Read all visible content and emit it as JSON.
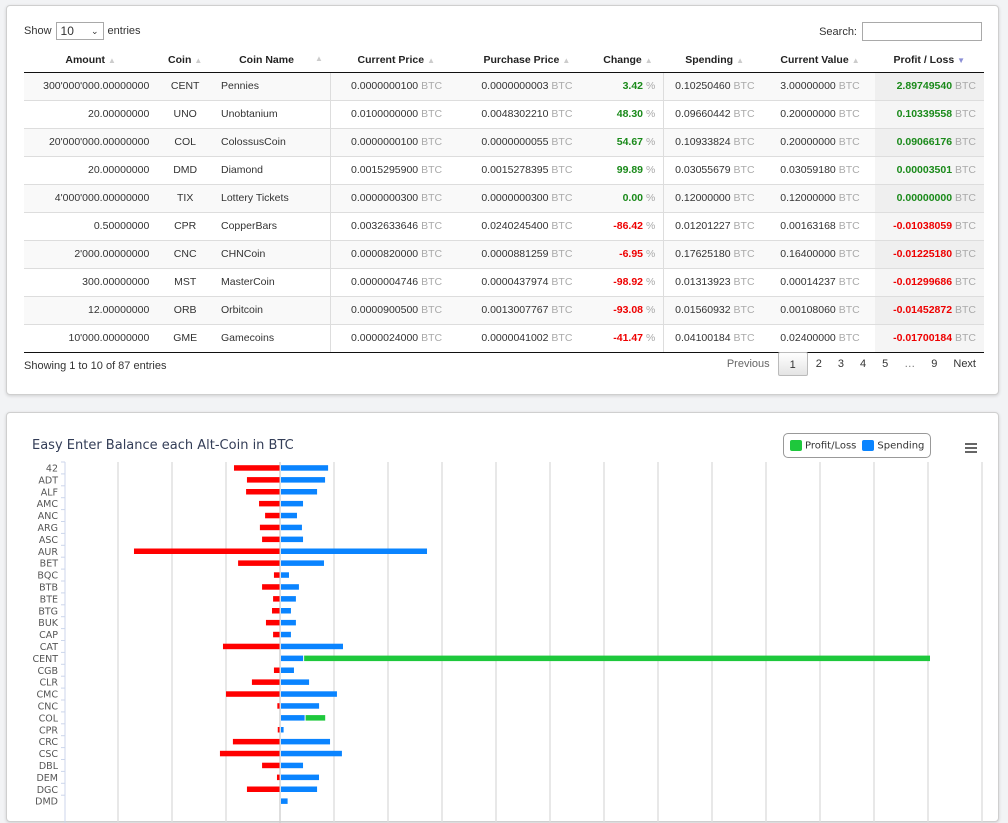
{
  "table": {
    "length_label_pre": "Show",
    "length_value": "10",
    "length_label_post": "entries",
    "search_label": "Search:",
    "search_value": "",
    "columns": [
      {
        "label": "Amount",
        "sort": "both"
      },
      {
        "label": "Coin",
        "sort": "both"
      },
      {
        "label": "Coin Name",
        "sort": "both"
      },
      {
        "label": "Current Price",
        "sort": "both"
      },
      {
        "label": "Purchase Price",
        "sort": "both"
      },
      {
        "label": "Change",
        "sort": "both"
      },
      {
        "label": "Spending",
        "sort": "both"
      },
      {
        "label": "Current Value",
        "sort": "both"
      },
      {
        "label": "Profit / Loss",
        "sort": "desc"
      }
    ],
    "unit_btc": "BTC",
    "unit_pct": "%",
    "rows": [
      {
        "amount": "300'000'000.00000000",
        "coin": "CENT",
        "name": "Pennies",
        "current_price": "0.0000000100",
        "purchase_price": "0.0000000003",
        "change": "3.42",
        "change_sign": "pos",
        "spending": "0.10250460",
        "current_value": "3.00000000",
        "profit": "2.89749540",
        "profit_sign": "pos"
      },
      {
        "amount": "20.00000000",
        "coin": "UNO",
        "name": "Unobtanium",
        "current_price": "0.0100000000",
        "purchase_price": "0.0048302210",
        "change": "48.30",
        "change_sign": "pos",
        "spending": "0.09660442",
        "current_value": "0.20000000",
        "profit": "0.10339558",
        "profit_sign": "pos"
      },
      {
        "amount": "20'000'000.00000000",
        "coin": "COL",
        "name": "ColossusCoin",
        "current_price": "0.0000000100",
        "purchase_price": "0.0000000055",
        "change": "54.67",
        "change_sign": "pos",
        "spending": "0.10933824",
        "current_value": "0.20000000",
        "profit": "0.09066176",
        "profit_sign": "pos"
      },
      {
        "amount": "20.00000000",
        "coin": "DMD",
        "name": "Diamond",
        "current_price": "0.0015295900",
        "purchase_price": "0.0015278395",
        "change": "99.89",
        "change_sign": "pos",
        "spending": "0.03055679",
        "current_value": "0.03059180",
        "profit": "0.00003501",
        "profit_sign": "pos"
      },
      {
        "amount": "4'000'000.00000000",
        "coin": "TIX",
        "name": "Lottery Tickets",
        "current_price": "0.0000000300",
        "purchase_price": "0.0000000300",
        "change": "0.00",
        "change_sign": "pos",
        "spending": "0.12000000",
        "current_value": "0.12000000",
        "profit": "0.00000000",
        "profit_sign": "pos"
      },
      {
        "amount": "0.50000000",
        "coin": "CPR",
        "name": "CopperBars",
        "current_price": "0.0032633646",
        "purchase_price": "0.0240245400",
        "change": "-86.42",
        "change_sign": "neg",
        "spending": "0.01201227",
        "current_value": "0.00163168",
        "profit": "-0.01038059",
        "profit_sign": "neg"
      },
      {
        "amount": "2'000.00000000",
        "coin": "CNC",
        "name": "CHNCoin",
        "current_price": "0.0000820000",
        "purchase_price": "0.0000881259",
        "change": "-6.95",
        "change_sign": "neg",
        "spending": "0.17625180",
        "current_value": "0.16400000",
        "profit": "-0.01225180",
        "profit_sign": "neg"
      },
      {
        "amount": "300.00000000",
        "coin": "MST",
        "name": "MasterCoin",
        "current_price": "0.0000004746",
        "purchase_price": "0.0000437974",
        "change": "-98.92",
        "change_sign": "neg",
        "spending": "0.01313923",
        "current_value": "0.00014237",
        "profit": "-0.01299686",
        "profit_sign": "neg"
      },
      {
        "amount": "12.00000000",
        "coin": "ORB",
        "name": "Orbitcoin",
        "current_price": "0.0000900500",
        "purchase_price": "0.0013007767",
        "change": "-93.08",
        "change_sign": "neg",
        "spending": "0.01560932",
        "current_value": "0.00108060",
        "profit": "-0.01452872",
        "profit_sign": "neg"
      },
      {
        "amount": "10'000.00000000",
        "coin": "GME",
        "name": "Gamecoins",
        "current_price": "0.0000024000",
        "purchase_price": "0.0000041002",
        "change": "-41.47",
        "change_sign": "neg",
        "spending": "0.04100184",
        "current_value": "0.02400000",
        "profit": "-0.01700184",
        "profit_sign": "neg"
      }
    ],
    "info": "Showing 1 to 10 of 87 entries",
    "pagination": {
      "previous": "Previous",
      "next": "Next",
      "pages": [
        "1",
        "2",
        "3",
        "4",
        "5",
        "…",
        "9"
      ],
      "current": "1"
    }
  },
  "colors": {
    "profit": "#1ec83c",
    "loss": "#ff0000",
    "spending": "#0a84ff",
    "positive_text": "#1a8a1a",
    "negative_text": "#ee0000"
  },
  "chart": {
    "menu_icon": "hamburger-menu-icon"
  },
  "chart_data": {
    "type": "bar",
    "orientation": "horizontal",
    "stacked": true,
    "title": "Easy Enter Balance each Alt-Coin in BTC",
    "xlabel": "",
    "ylabel": "",
    "legend": {
      "position": "top-right",
      "entries": [
        "Profit/Loss",
        "Spending"
      ]
    },
    "grid": true,
    "xlim": [
      -1.0,
      3.25
    ],
    "x_gridline_step": 0.25,
    "categories": [
      "42",
      "ADT",
      "ALF",
      "AMC",
      "ANC",
      "ARG",
      "ASC",
      "AUR",
      "BET",
      "BQC",
      "BTB",
      "BTE",
      "BTG",
      "BUK",
      "CAP",
      "CAT",
      "CENT",
      "CGB",
      "CLR",
      "CMC",
      "CNC",
      "COL",
      "CPR",
      "CRC",
      "CSC",
      "DBL",
      "DEM",
      "DGC",
      "DMD"
    ],
    "series": [
      {
        "name": "Profit/Loss",
        "values": [
          -0.213,
          -0.153,
          -0.157,
          -0.097,
          -0.069,
          -0.093,
          -0.083,
          -0.676,
          -0.194,
          -0.028,
          -0.083,
          -0.032,
          -0.037,
          -0.065,
          -0.032,
          -0.264,
          2.8975,
          -0.028,
          -0.13,
          -0.25,
          -0.0123,
          0.0907,
          -0.0104,
          -0.218,
          -0.278,
          -0.083,
          -0.014,
          -0.153,
          4e-05
        ]
      },
      {
        "name": "Spending",
        "values": [
          0.218,
          0.204,
          0.167,
          0.102,
          0.074,
          0.097,
          0.102,
          0.676,
          0.199,
          0.037,
          0.083,
          0.069,
          0.046,
          0.069,
          0.046,
          0.287,
          0.1025,
          0.06,
          0.13,
          0.259,
          0.1763,
          0.1093,
          0.012,
          0.227,
          0.282,
          0.102,
          0.176,
          0.167,
          0.0306
        ]
      }
    ]
  }
}
